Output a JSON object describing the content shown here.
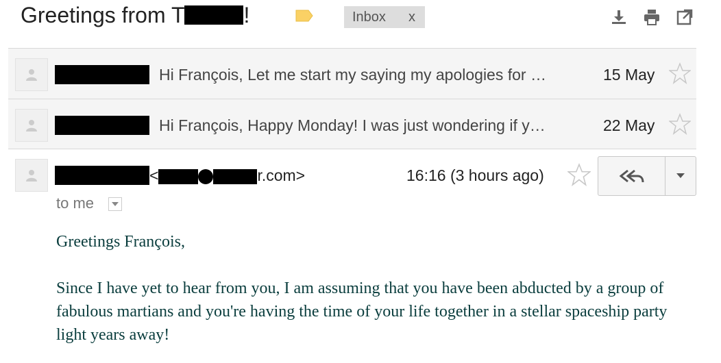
{
  "header": {
    "subject_start": "Greetings from T",
    "subject_end": "!",
    "label_chip": "Inbox",
    "label_chip_remove": "x",
    "icons": [
      "download-icon",
      "print-icon",
      "new-window-icon",
      "label-tag-icon"
    ]
  },
  "threads": [
    {
      "snippet": "Hi François, Let me start my saying my apologies for …",
      "date": "15 May"
    },
    {
      "snippet": "Hi François, Happy Monday! I was just wondering if y…",
      "date": "22 May"
    }
  ],
  "open_message": {
    "email_open": "<",
    "email_suffix": "r.com>",
    "time": "16:16 (3 hours ago)",
    "recipient": "to me",
    "greeting": "Greetings François,",
    "paragraph": "Since I have yet to hear from you, I am assuming that you have been abducted by a group of fabulous martians and you're having the time of your life together in a stellar spaceship party light years away!"
  },
  "colors": {
    "label_tag": "#fad165",
    "body_text": "#0a3d3d",
    "thread_bg": "#f5f5f5",
    "chip_bg": "#dddddd"
  }
}
